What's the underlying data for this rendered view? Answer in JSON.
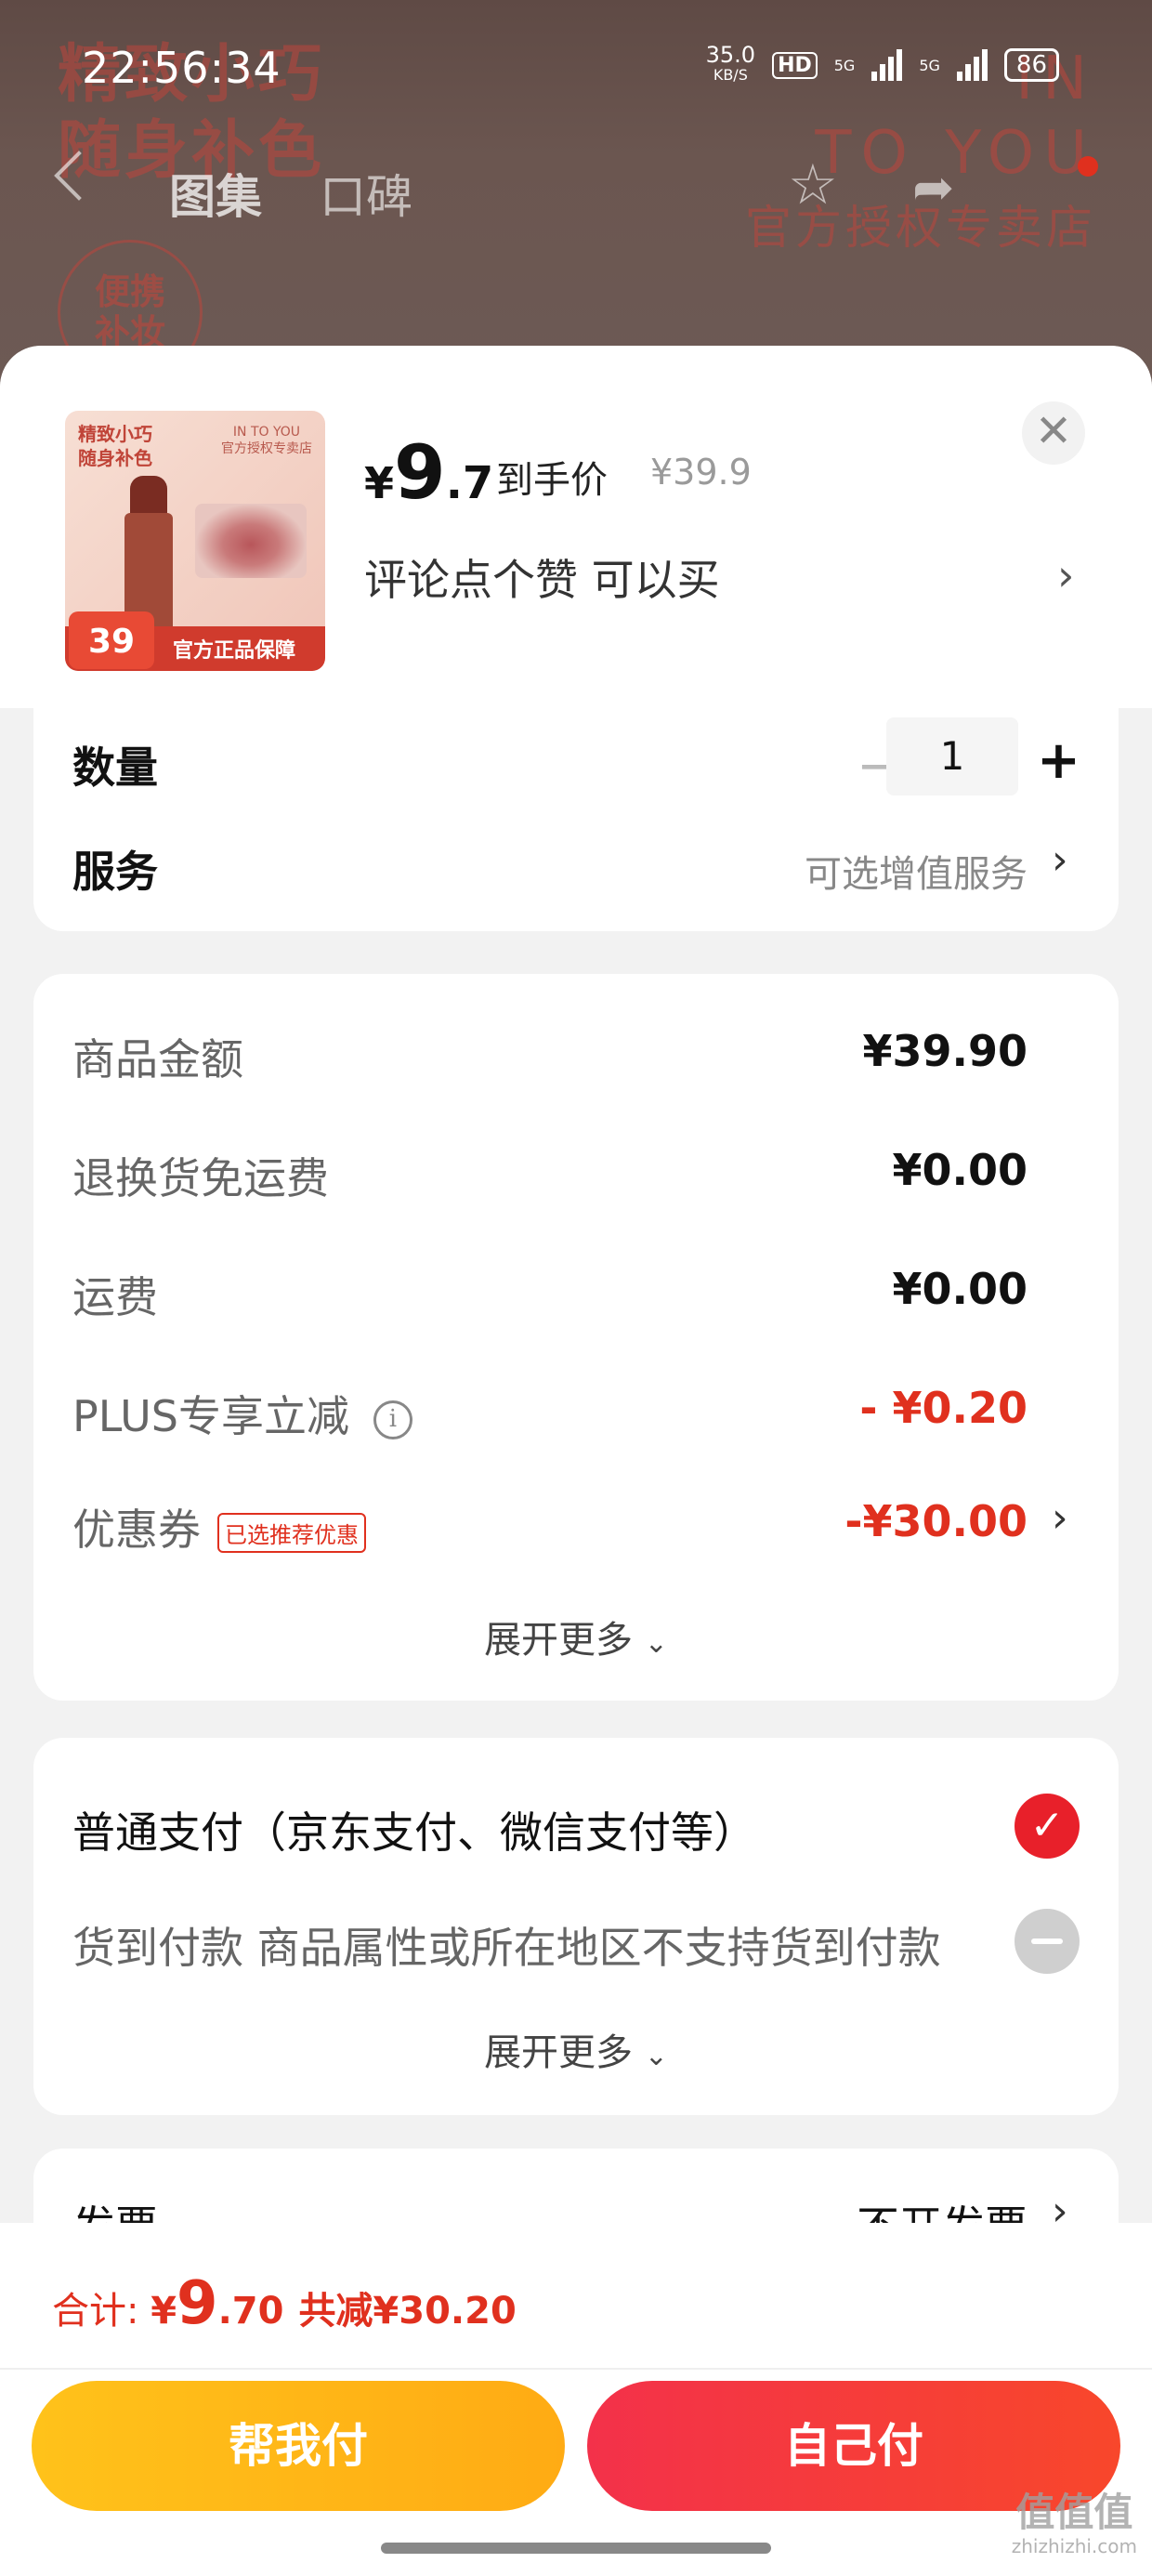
{
  "status_bar": {
    "time": "22:56:34",
    "net_speed_value": "35.0",
    "net_speed_unit": "KB/S",
    "hd_label": "HD",
    "signal_a": "5G",
    "signal_b": "5G",
    "battery": "86"
  },
  "backdrop": {
    "slogan_line1": "精致小巧",
    "slogan_line2": "随身补色",
    "stamp_text_line1": "便携",
    "stamp_text_line2": "补妆",
    "brand_line1": "IN",
    "brand_line2": "TO YOU",
    "brand_store": "官方授权专卖店",
    "nav_tabs": [
      "图集",
      "口碑"
    ]
  },
  "product": {
    "thumb_slogan_line1": "精致小巧",
    "thumb_slogan_line2": "随身补色",
    "thumb_brand": "IN TO YOU",
    "thumb_store": "官方授权专卖店",
    "thumb_badge_price": "39",
    "thumb_guarantee": "官方正品保障",
    "price_currency": "¥",
    "price_int": "9",
    "price_dec": ".7",
    "price_tag": "到手价",
    "original_price": "¥39.9",
    "promo_text": "评论点个赞  可以买"
  },
  "quantity": {
    "label": "数量",
    "value": "1",
    "minus": "−",
    "plus": "+"
  },
  "service": {
    "label": "服务",
    "value": "可选增值服务"
  },
  "costs": [
    {
      "label": "商品金额",
      "value": "¥39.90",
      "red": false
    },
    {
      "label": "退换货免运费",
      "value": "¥0.00",
      "red": false
    },
    {
      "label": "运费",
      "value": "¥0.00",
      "red": false
    },
    {
      "label": "PLUS专享立减",
      "value": "- ¥0.20",
      "red": true
    },
    {
      "label": "优惠券",
      "value": "-¥30.00",
      "red": true,
      "tag": "已选推荐优惠"
    }
  ],
  "expand_more": "展开更多",
  "payment": {
    "option1": "普通支付（京东支付、微信支付等）",
    "option2": "货到付款 商品属性或所在地区不支持货到付款",
    "expand_more": "展开更多"
  },
  "invoice": {
    "label": "发票",
    "value": "不开发票"
  },
  "footer": {
    "total_label": "合计: ",
    "total_currency": "¥",
    "total_int": "9",
    "total_dec": ".70",
    "saved": "共减¥30.20",
    "btn_help_pay": "帮我付",
    "btn_self_pay": "自己付"
  },
  "watermark": {
    "main": "值值值",
    "sub": "zhizhizhi.com"
  },
  "colors": {
    "accent_red": "#e0301e",
    "help_pay_yellow": "#ffb815",
    "self_pay_red": "#f53d3a"
  }
}
